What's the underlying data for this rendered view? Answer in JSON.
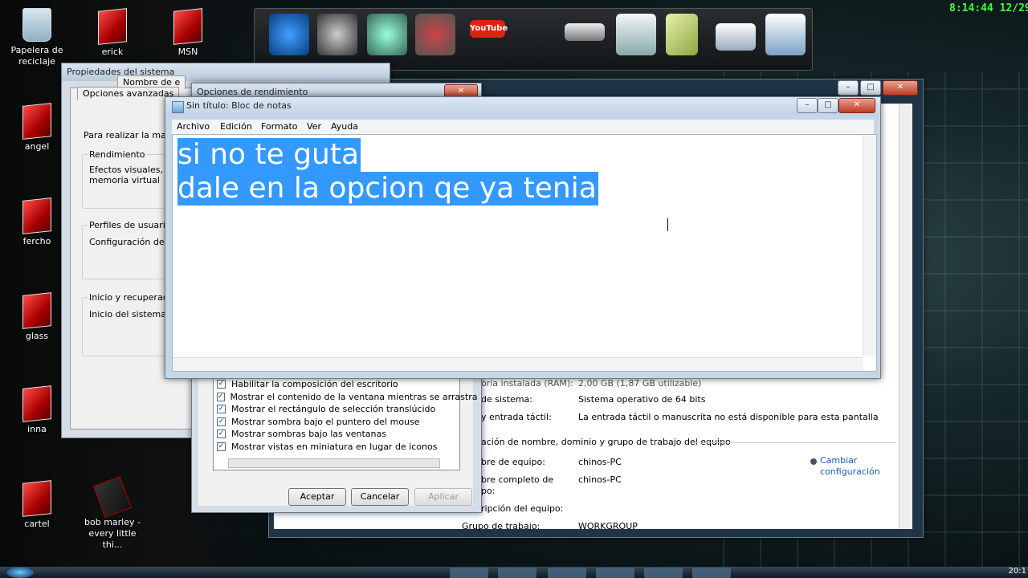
{
  "desktop": {
    "icons": [
      {
        "label": "Papelera de reciclaje",
        "line1": "Papelera de",
        "line2": "reciclaje",
        "icon": "recycle-bin-icon"
      },
      {
        "label": "erick",
        "icon": "red-folder-icon"
      },
      {
        "label": "MSN",
        "icon": "red-folder-icon"
      },
      {
        "label": "angel",
        "icon": "red-folder-icon"
      },
      {
        "label": "fercho",
        "icon": "red-folder-icon"
      },
      {
        "label": "glass",
        "icon": "red-folder-icon"
      },
      {
        "label": "inna",
        "icon": "red-folder-icon"
      },
      {
        "label": "cartel",
        "icon": "red-folder-icon"
      },
      {
        "label": "bob marley - every little thi...",
        "line1": "bob marley -",
        "line2": "every little thi...",
        "icon": "music-file-icon"
      }
    ]
  },
  "clock": "8:14:44  12/29/",
  "dock": {
    "items": [
      "headphones-icon",
      "turntable-icon",
      "globe-icon",
      "messenger-icon",
      "youtube-icon",
      "printer-icon",
      "itunes-icon",
      "notes-icon",
      "window-icon",
      "browser-icon"
    ],
    "youtube_label": "YouTube"
  },
  "props_window": {
    "title": "Propiedades del sistema",
    "tab_partial": "Nombre de e",
    "tab_active": "Opciones avanzadas",
    "intro": "Para realizar la mayor",
    "perf_group": {
      "title": "Rendimiento",
      "line1": "Efectos visuales, pro",
      "line2": "memoria virtual"
    },
    "profiles_group": {
      "title": "Perfiles de usuario",
      "line1": "Configuración del esc"
    },
    "startup_group": {
      "title": "Inicio y recuperación",
      "line1": "Inicio del sistema, err"
    }
  },
  "perf_window": {
    "title": "Opciones de rendimiento",
    "close": "✕",
    "checklist": [
      "Habilitar la composición del escritorio",
      "Mostrar el contenido de la ventana mientras se arrastra",
      "Mostrar el rectángulo de selección translúcido",
      "Mostrar sombra bajo el puntero del mouse",
      "Mostrar sombras bajo las ventanas",
      "Mostrar vistas en miniatura en lugar de iconos"
    ],
    "accept": "Aceptar",
    "cancel": "Cancelar",
    "apply": "Aplicar"
  },
  "system_window": {
    "rows": [
      {
        "label": "oria instalada (RAM):",
        "value": "2,00 GB (1,87 GB utilizable)"
      },
      {
        "label": "de sistema:",
        "value": "Sistema operativo de 64 bits"
      },
      {
        "label": "y entrada táctil:",
        "value": "La entrada táctil o manuscrita no está disponible para esta pantalla"
      }
    ],
    "section": "ación de nombre, dominio y grupo de trabajo del equipo",
    "name_rows": [
      {
        "label": "bre de equipo:",
        "value": "chinos-PC"
      },
      {
        "label": "bre completo de",
        "label2": "po:",
        "value": "chinos-PC"
      },
      {
        "label": "ripción del equipo:",
        "value": ""
      },
      {
        "label": "Grupo de trabajo:",
        "value": "WORKGROUP"
      }
    ],
    "change_link_line1": "Cambiar",
    "change_link_line2": "configuración"
  },
  "notepad": {
    "title": "Sin título: Bloc de notas",
    "menu": [
      "Archivo",
      "Edición",
      "Formato",
      "Ver",
      "Ayuda"
    ],
    "line1": "si no te guta",
    "line2": "dale en la opcion qe ya tenia"
  },
  "taskbar": {
    "clock": "20:1"
  }
}
